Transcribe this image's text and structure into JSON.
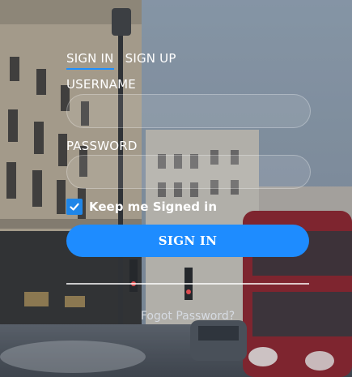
{
  "tabs": [
    {
      "label": "SIGN IN",
      "active": true
    },
    {
      "label": "SIGN UP",
      "active": false
    }
  ],
  "username": {
    "label": "USERNAME",
    "value": ""
  },
  "password": {
    "label": "PASSWORD",
    "value": ""
  },
  "keep_signed_in": {
    "label": "Keep me Signed in",
    "checked": true
  },
  "sign_in_button": "SIGN IN",
  "forgot_link": "Fogot Password?",
  "colors": {
    "accent": "#1e8cff",
    "checkbox": "#1f86e8",
    "bus": "#8a1a22"
  }
}
